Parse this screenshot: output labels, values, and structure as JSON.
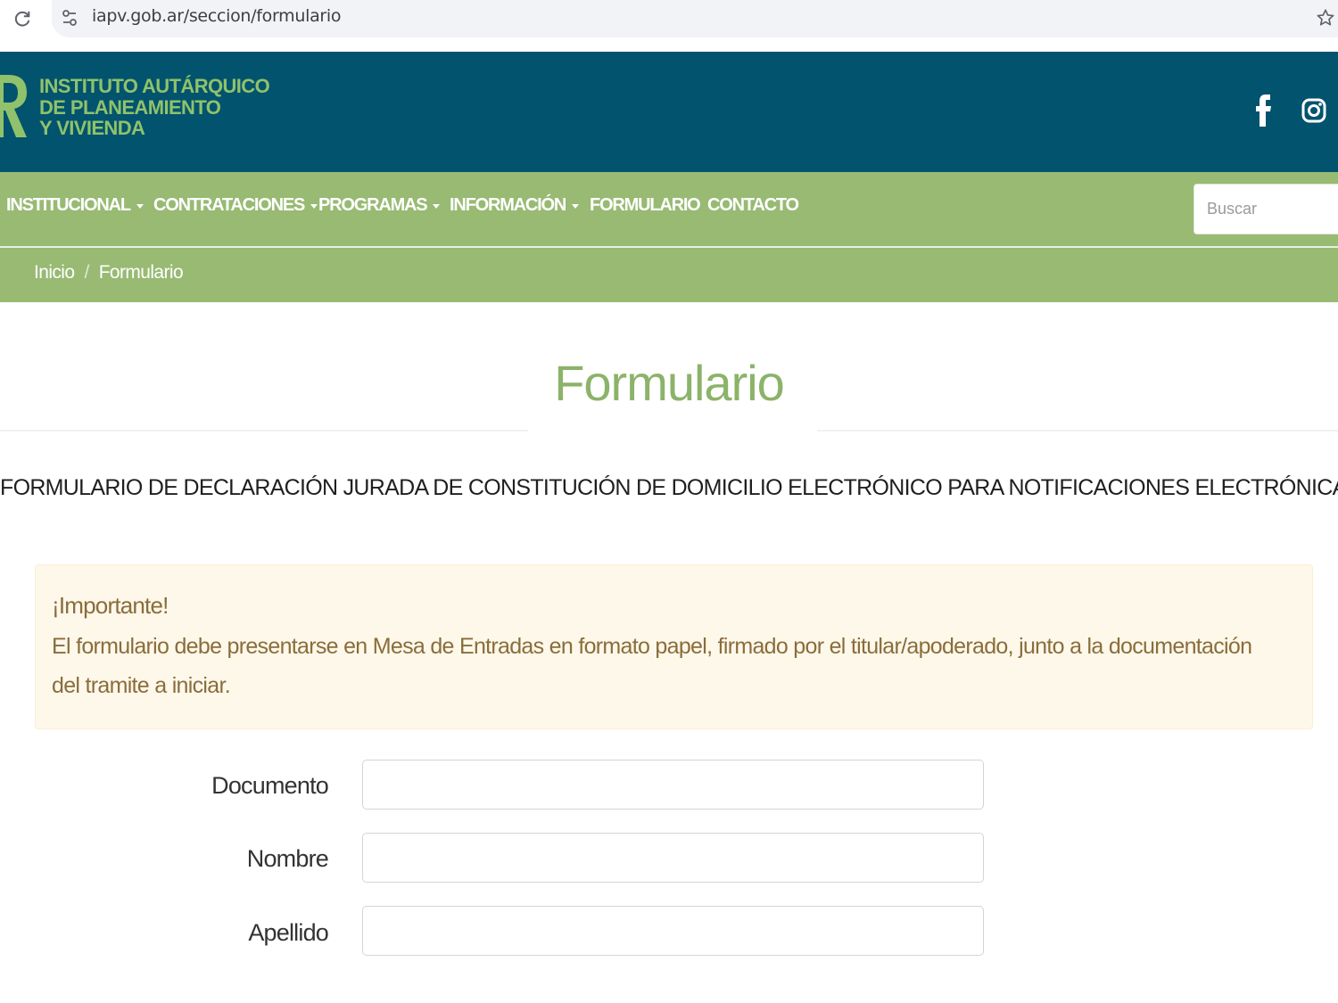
{
  "browser": {
    "url": "iapv.gob.ar/seccion/formulario"
  },
  "header": {
    "logo_lines": [
      "INSTITUTO AUTÁRQUICO",
      "DE PLANEAMIENTO",
      "Y VIVIENDA"
    ]
  },
  "nav": {
    "items": [
      {
        "label": "INSTITUCIONAL",
        "dropdown": true
      },
      {
        "label": "CONTRATACIONES",
        "dropdown": true
      },
      {
        "label": "PROGRAMAS",
        "dropdown": true
      },
      {
        "label": "INFORMACIÓN",
        "dropdown": true
      },
      {
        "label": "FORMULARIO",
        "dropdown": false
      },
      {
        "label": "CONTACTO",
        "dropdown": false
      }
    ],
    "search_placeholder": "Buscar"
  },
  "breadcrumb": {
    "home": "Inicio",
    "separator": "/",
    "current": "Formulario"
  },
  "main": {
    "title": "Formulario",
    "heading": "FORMULARIO DE DECLARACIÓN JURADA DE CONSTITUCIÓN DE DOMICILIO ELECTRÓNICO PARA NOTIFICACIONES ELECTRÓNICAS.",
    "alert": {
      "title": "¡Importante!",
      "body": "El formulario debe presentarse en Mesa de Entradas en formato papel, firmado por el titular/apoderado, junto a la documentación del tramite a iniciar."
    },
    "fields": [
      {
        "label": "Documento",
        "value": ""
      },
      {
        "label": "Nombre",
        "value": ""
      },
      {
        "label": "Apellido",
        "value": ""
      }
    ]
  },
  "colors": {
    "header_bg": "#02536e",
    "nav_bg": "#98ba73",
    "logo_green": "#8fc26b",
    "title_green": "#8cb36a",
    "alert_bg": "#fef8ea",
    "alert_text": "#8a6d3b"
  },
  "icons": [
    "reload-icon",
    "site-info-icon",
    "star-icon",
    "facebook-icon",
    "instagram-icon",
    "chevron-down-icon"
  ]
}
